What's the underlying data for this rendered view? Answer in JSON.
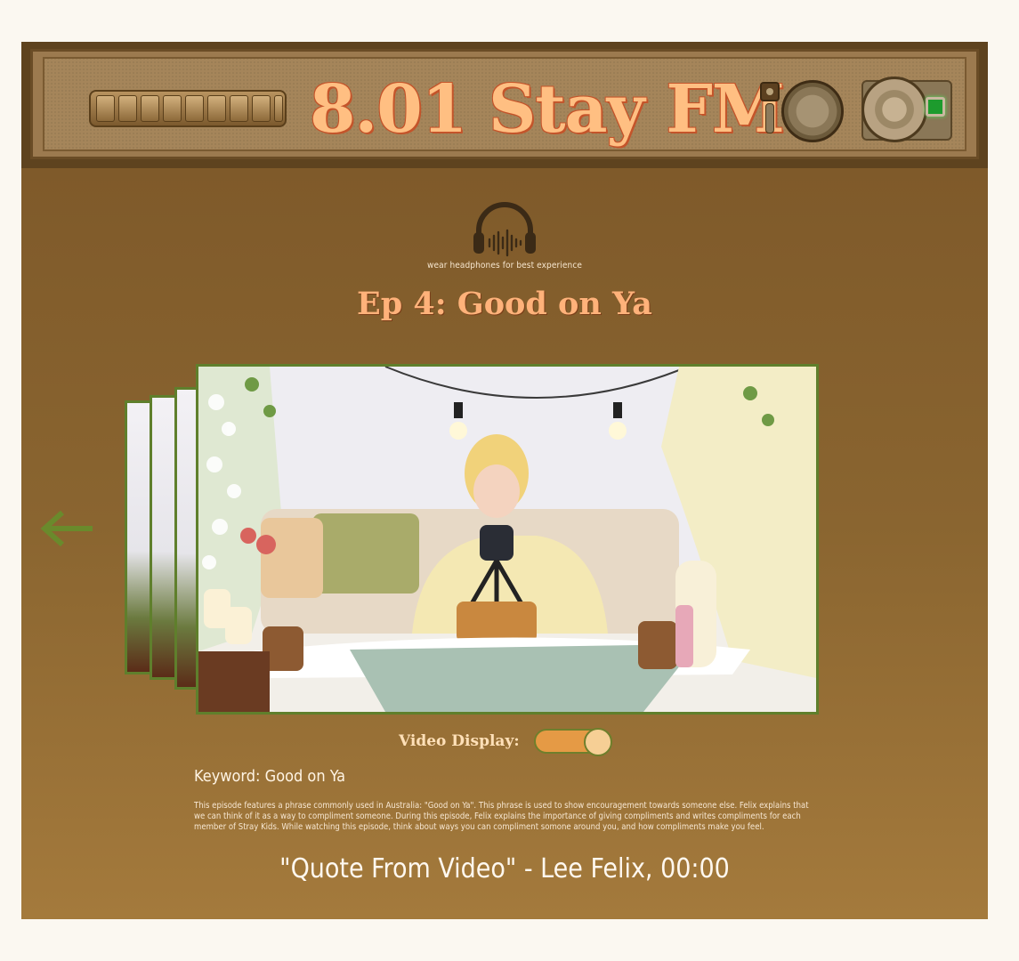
{
  "header": {
    "brand": "8.01 Stay FM"
  },
  "main": {
    "headphone_note": "wear headphones for best experience",
    "episode_title": "Ep 4: Good on Ya",
    "video_toggle_label": "Video Display:",
    "video_toggle_on": true,
    "keyword": "Keyword: Good on Ya",
    "description": "This episode features a phrase commonly used in Australia: \"Good on Ya\". This phrase is used to show encouragement towards someone else. Felix explains that we can think of it as a way to compliment someone. During this episode, Felix explains the importance of giving compliments and writes compliments for each member of Stray Kids. While watching this episode, think about ways you can compliment somone around you, and how compliments make you feel.",
    "quote": "\"Quote From Video\" - Lee Felix, 00:00"
  },
  "icons": {
    "headphones": "headphones-icon",
    "back": "arrow-left-icon"
  },
  "colors": {
    "accent_title": "#ffb27a",
    "frame_green": "#5f7f2c",
    "toggle_on": "#e59a45"
  }
}
